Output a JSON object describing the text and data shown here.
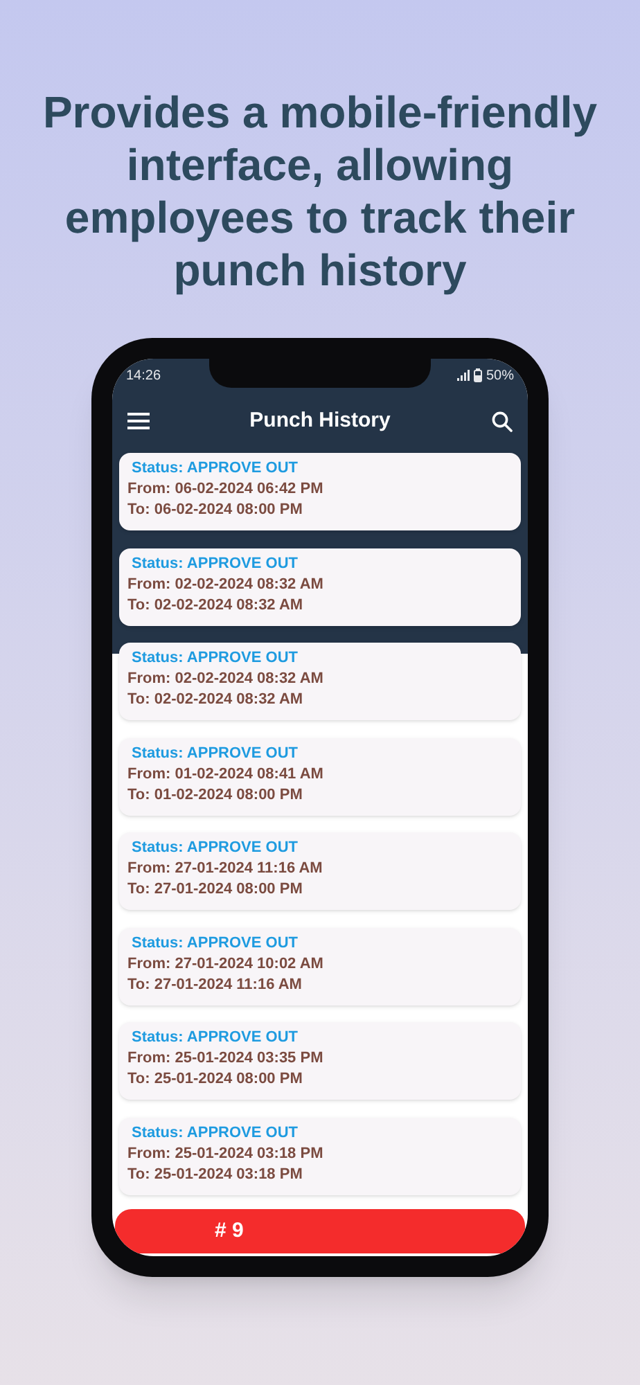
{
  "headline": "Provides a mobile-friendly interface, allowing employees to track their punch history",
  "status_bar": {
    "time": "14:26",
    "battery": "50%"
  },
  "app_bar": {
    "title": "Punch History"
  },
  "records": [
    {
      "status": "Status: APPROVE OUT",
      "from": "From: 06-02-2024 06:42 PM",
      "to": "To: 06-02-2024 08:00 PM"
    },
    {
      "status": "Status: APPROVE OUT",
      "from": "From: 02-02-2024 08:32 AM",
      "to": "To: 02-02-2024 08:32 AM"
    },
    {
      "status": "Status: APPROVE OUT",
      "from": "From: 02-02-2024 08:32 AM",
      "to": "To: 02-02-2024 08:32 AM"
    },
    {
      "status": "Status: APPROVE OUT",
      "from": "From: 01-02-2024 08:41 AM",
      "to": "To: 01-02-2024 08:00 PM"
    },
    {
      "status": "Status: APPROVE OUT",
      "from": "From: 27-01-2024 11:16 AM",
      "to": "To: 27-01-2024 08:00 PM"
    },
    {
      "status": "Status: APPROVE OUT",
      "from": "From: 27-01-2024 10:02 AM",
      "to": "To: 27-01-2024 11:16 AM"
    },
    {
      "status": "Status: APPROVE OUT",
      "from": "From: 25-01-2024 03:35 PM",
      "to": "To: 25-01-2024 08:00 PM"
    },
    {
      "status": "Status: APPROVE OUT",
      "from": "From: 25-01-2024 03:18 PM",
      "to": "To: 25-01-2024 03:18 PM"
    }
  ],
  "footer": {
    "label": "# 9"
  }
}
